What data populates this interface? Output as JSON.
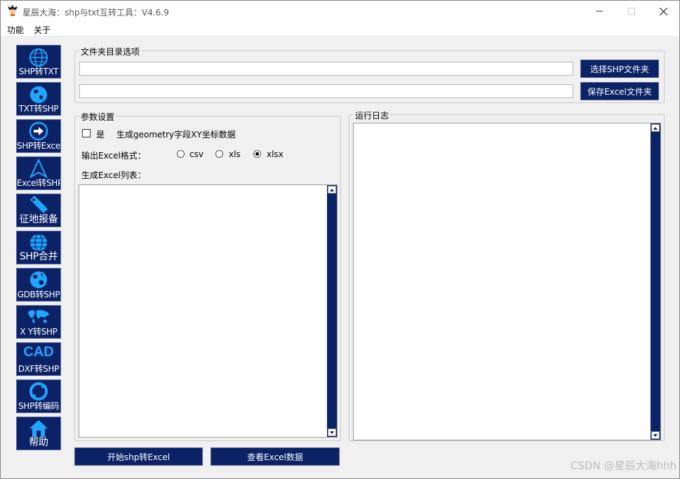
{
  "window": {
    "title": "星辰大海：shp与txt互转工具：V4.6.9"
  },
  "menu": [
    "功能",
    "关于"
  ],
  "sidebar": [
    {
      "label": "SHP转TXT",
      "icon": "globe-icon"
    },
    {
      "label": "TXT转SHP",
      "icon": "earth-icon"
    },
    {
      "label": "SHP转Excel",
      "icon": "arrow-circle-icon"
    },
    {
      "label": "Excel转SHP",
      "icon": "navigation-arrow-icon"
    },
    {
      "label": "征地报备",
      "icon": "tag-icon"
    },
    {
      "label": "SHP合并",
      "icon": "globe-grid-icon"
    },
    {
      "label": "GDB转SHP",
      "icon": "world-icon"
    },
    {
      "label": "X Y转SHP",
      "icon": "world-map-icon"
    },
    {
      "label": "DXF转SHP",
      "icon": "cad-icon",
      "icon_text": "CAD"
    },
    {
      "label": "SHP转编码",
      "icon": "refresh-icon"
    },
    {
      "label": "帮助",
      "icon": "home-icon"
    }
  ],
  "folder_group": {
    "title": "文件夹目录选项",
    "input1_value": "",
    "input2_value": "",
    "select_button": "选择SHP文件夹",
    "save_button": "保存Excel文件夹"
  },
  "params": {
    "title": "参数设置",
    "checkbox_label": "是",
    "checkbox_desc": "生成geometry字段XY坐标数据",
    "checkbox_checked": false,
    "format_label": "输出Excel格式：",
    "formats": [
      {
        "label": "csv",
        "selected": false
      },
      {
        "label": "xls",
        "selected": false
      },
      {
        "label": "xlsx",
        "selected": true
      }
    ],
    "columns_label": "生成Excel列表："
  },
  "log": {
    "title": "运行日志"
  },
  "actions": {
    "start": "开始shp转Excel",
    "view": "查看Excel数据"
  },
  "watermark": "CSDN @星辰大海hhh",
  "colors": {
    "button_bg": "#0c2266",
    "icon_blue": "#1fa6ff",
    "window_bg": "#f0f0f0"
  }
}
